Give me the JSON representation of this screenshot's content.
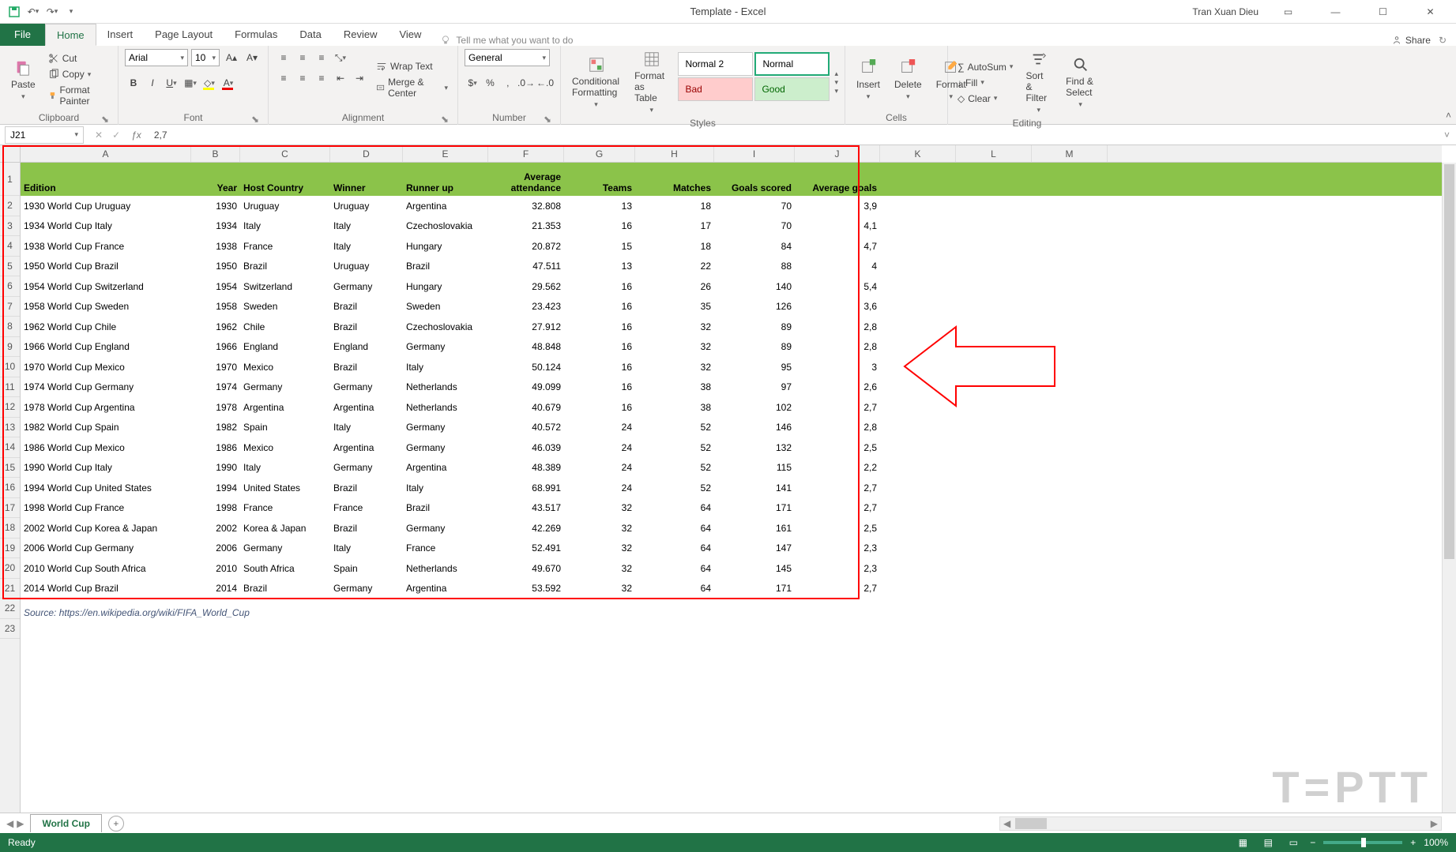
{
  "app": {
    "title": "Template - Excel",
    "user": "Tran Xuan Dieu"
  },
  "qat": {
    "save": "save",
    "undo": "undo",
    "redo": "redo"
  },
  "tabs": {
    "file": "File",
    "home": "Home",
    "insert": "Insert",
    "page_layout": "Page Layout",
    "formulas": "Formulas",
    "data": "Data",
    "review": "Review",
    "view": "View",
    "tell_me": "Tell me what you want to do",
    "share": "Share"
  },
  "ribbon": {
    "paste": "Paste",
    "cut": "Cut",
    "copy": "Copy",
    "format_painter": "Format Painter",
    "font_name": "Arial",
    "font_size": "10",
    "wrap_text": "Wrap Text",
    "merge_center": "Merge & Center",
    "number_format": "General",
    "cond_fmt": "Conditional Formatting",
    "fmt_table": "Format as Table",
    "style_normal2": "Normal 2",
    "style_normal": "Normal",
    "style_bad": "Bad",
    "style_good": "Good",
    "insert_btn": "Insert",
    "delete_btn": "Delete",
    "format_btn": "Format",
    "autosum": "AutoSum",
    "fill": "Fill",
    "clear": "Clear",
    "sort_filter": "Sort & Filter",
    "find_select": "Find & Select",
    "grp_clipboard": "Clipboard",
    "grp_font": "Font",
    "grp_alignment": "Alignment",
    "grp_number": "Number",
    "grp_styles": "Styles",
    "grp_cells": "Cells",
    "grp_editing": "Editing"
  },
  "formula_bar": {
    "name_box": "J21",
    "value": "2,7"
  },
  "columns": [
    "A",
    "B",
    "C",
    "D",
    "E",
    "F",
    "G",
    "H",
    "I",
    "J",
    "K",
    "L",
    "M"
  ],
  "rows": [
    "1",
    "2",
    "3",
    "4",
    "5",
    "6",
    "7",
    "8",
    "9",
    "10",
    "11",
    "12",
    "13",
    "14",
    "15",
    "16",
    "17",
    "18",
    "19",
    "20",
    "21",
    "22",
    "23"
  ],
  "headers": {
    "A": "Edition",
    "B": "Year",
    "C": "Host Country",
    "D": "Winner",
    "E": "Runner up",
    "F": "Average attendance",
    "G": "Teams",
    "H": "Matches",
    "I": "Goals scored",
    "J": "Average goals"
  },
  "data": [
    {
      "A": "1930 World Cup Uruguay",
      "B": "1930",
      "C": "Uruguay",
      "D": "Uruguay",
      "E": "Argentina",
      "F": "32.808",
      "G": "13",
      "H": "18",
      "I": "70",
      "J": "3,9"
    },
    {
      "A": "1934 World Cup Italy",
      "B": "1934",
      "C": "Italy",
      "D": "Italy",
      "E": "Czechoslovakia",
      "F": "21.353",
      "G": "16",
      "H": "17",
      "I": "70",
      "J": "4,1"
    },
    {
      "A": "1938 World Cup France",
      "B": "1938",
      "C": "France",
      "D": "Italy",
      "E": "Hungary",
      "F": "20.872",
      "G": "15",
      "H": "18",
      "I": "84",
      "J": "4,7"
    },
    {
      "A": "1950 World Cup Brazil",
      "B": "1950",
      "C": "Brazil",
      "D": "Uruguay",
      "E": "Brazil",
      "F": "47.511",
      "G": "13",
      "H": "22",
      "I": "88",
      "J": "4"
    },
    {
      "A": "1954 World Cup Switzerland",
      "B": "1954",
      "C": "Switzerland",
      "D": "Germany",
      "E": "Hungary",
      "F": "29.562",
      "G": "16",
      "H": "26",
      "I": "140",
      "J": "5,4"
    },
    {
      "A": "1958 World Cup Sweden",
      "B": "1958",
      "C": "Sweden",
      "D": "Brazil",
      "E": "Sweden",
      "F": "23.423",
      "G": "16",
      "H": "35",
      "I": "126",
      "J": "3,6"
    },
    {
      "A": "1962 World Cup Chile",
      "B": "1962",
      "C": "Chile",
      "D": "Brazil",
      "E": "Czechoslovakia",
      "F": "27.912",
      "G": "16",
      "H": "32",
      "I": "89",
      "J": "2,8"
    },
    {
      "A": "1966 World Cup England",
      "B": "1966",
      "C": "England",
      "D": "England",
      "E": "Germany",
      "F": "48.848",
      "G": "16",
      "H": "32",
      "I": "89",
      "J": "2,8"
    },
    {
      "A": "1970 World Cup Mexico",
      "B": "1970",
      "C": "Mexico",
      "D": "Brazil",
      "E": "Italy",
      "F": "50.124",
      "G": "16",
      "H": "32",
      "I": "95",
      "J": "3"
    },
    {
      "A": "1974 World Cup Germany",
      "B": "1974",
      "C": "Germany",
      "D": "Germany",
      "E": "Netherlands",
      "F": "49.099",
      "G": "16",
      "H": "38",
      "I": "97",
      "J": "2,6"
    },
    {
      "A": "1978 World Cup Argentina",
      "B": "1978",
      "C": "Argentina",
      "D": "Argentina",
      "E": "Netherlands",
      "F": "40.679",
      "G": "16",
      "H": "38",
      "I": "102",
      "J": "2,7"
    },
    {
      "A": "1982 World Cup Spain",
      "B": "1982",
      "C": "Spain",
      "D": "Italy",
      "E": "Germany",
      "F": "40.572",
      "G": "24",
      "H": "52",
      "I": "146",
      "J": "2,8"
    },
    {
      "A": "1986 World Cup Mexico",
      "B": "1986",
      "C": "Mexico",
      "D": "Argentina",
      "E": "Germany",
      "F": "46.039",
      "G": "24",
      "H": "52",
      "I": "132",
      "J": "2,5"
    },
    {
      "A": "1990 World Cup Italy",
      "B": "1990",
      "C": "Italy",
      "D": "Germany",
      "E": "Argentina",
      "F": "48.389",
      "G": "24",
      "H": "52",
      "I": "115",
      "J": "2,2"
    },
    {
      "A": "1994 World Cup United States",
      "B": "1994",
      "C": "United States",
      "D": "Brazil",
      "E": "Italy",
      "F": "68.991",
      "G": "24",
      "H": "52",
      "I": "141",
      "J": "2,7"
    },
    {
      "A": "1998 World Cup France",
      "B": "1998",
      "C": "France",
      "D": "France",
      "E": "Brazil",
      "F": "43.517",
      "G": "32",
      "H": "64",
      "I": "171",
      "J": "2,7"
    },
    {
      "A": "2002 World Cup Korea & Japan",
      "B": "2002",
      "C": "Korea & Japan",
      "D": "Brazil",
      "E": "Germany",
      "F": "42.269",
      "G": "32",
      "H": "64",
      "I": "161",
      "J": "2,5"
    },
    {
      "A": "2006 World Cup Germany",
      "B": "2006",
      "C": "Germany",
      "D": "Italy",
      "E": "France",
      "F": "52.491",
      "G": "32",
      "H": "64",
      "I": "147",
      "J": "2,3"
    },
    {
      "A": "2010 World Cup South Africa",
      "B": "2010",
      "C": "South Africa",
      "D": "Spain",
      "E": "Netherlands",
      "F": "49.670",
      "G": "32",
      "H": "64",
      "I": "145",
      "J": "2,3"
    },
    {
      "A": "2014 World Cup Brazil",
      "B": "2014",
      "C": "Brazil",
      "D": "Germany",
      "E": "Argentina",
      "F": "53.592",
      "G": "32",
      "H": "64",
      "I": "171",
      "J": "2,7"
    }
  ],
  "source_row": "Source: https://en.wikipedia.org/wiki/FIFA_World_Cup",
  "sheet": {
    "name": "World Cup"
  },
  "status": {
    "ready": "Ready",
    "zoom": "100%"
  },
  "watermark": "T=PTT"
}
